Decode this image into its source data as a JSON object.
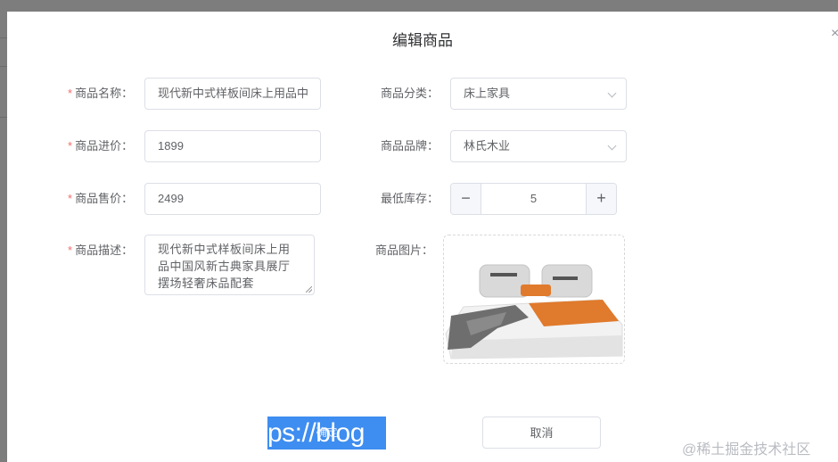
{
  "dialog": {
    "title": "编辑商品",
    "close_glyph": "×"
  },
  "form": {
    "required_mark": "*",
    "name": {
      "label": "商品名称：",
      "value": "现代新中式样板间床上用品中"
    },
    "purchase_price": {
      "label": "商品进价：",
      "value": "1899"
    },
    "sale_price": {
      "label": "商品售价：",
      "value": "2499"
    },
    "description": {
      "label": "商品描述：",
      "value": "现代新中式样板间床上用品中国风新古典家具展厅摆场轻奢床品配套"
    },
    "category": {
      "label": "商品分类：",
      "value": "床上家具"
    },
    "brand": {
      "label": "商品品牌：",
      "value": "林氏木业"
    },
    "min_stock": {
      "label": "最低库存：",
      "value": "5",
      "minus": "−",
      "plus": "+"
    },
    "image": {
      "label": "商品图片："
    }
  },
  "footer": {
    "confirm_label": "确定",
    "selection_text": "ps://blog",
    "cancel_label": "取消"
  },
  "watermark": "@稀土掘金技术社区",
  "colors": {
    "required": "#f56c6c",
    "selection": "#3e8df0",
    "border": "#dcdfe6"
  },
  "icons": {
    "close": "close-icon",
    "select_arrow": "chevron-down-icon",
    "minus": "minus-icon",
    "plus": "plus-icon"
  }
}
